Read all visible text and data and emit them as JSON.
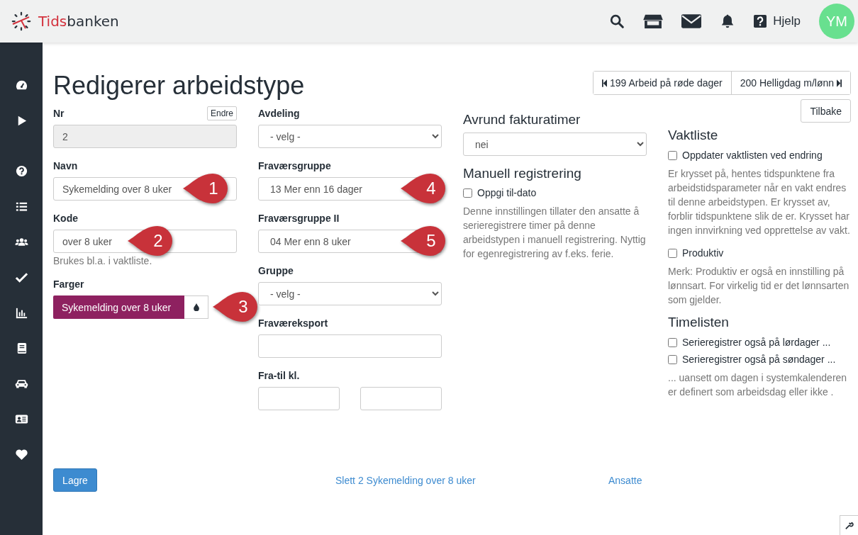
{
  "header": {
    "logo_primary": "Tids",
    "logo_secondary": "banken",
    "help_label": "Hjelp",
    "avatar_initials": "YM"
  },
  "page_title": "Redigerer arbeidstype",
  "nav": {
    "previous": "199 Arbeid på røde dager",
    "next": "200 Helligdag m/lønn"
  },
  "fields_left": [
    {
      "kind": "readonly",
      "label": "Nr",
      "action": "Endre",
      "value": "2"
    },
    {
      "kind": "text",
      "label": "Navn",
      "value": "Sykemelding over 8 uker",
      "callout": "1"
    },
    {
      "kind": "text",
      "label": "Kode",
      "value": "over 8 uker",
      "help": "Brukes bl.a. i vaktliste.",
      "callout": "2"
    },
    {
      "kind": "color",
      "label": "Farger",
      "value": "Sykemelding over 8 uker",
      "color": "#8e2160",
      "callout": "3"
    }
  ],
  "fields_middle": [
    {
      "kind": "select",
      "label": "Avdeling",
      "value": "- velg -"
    },
    {
      "kind": "select",
      "label": "Fraværsgruppe",
      "value": "13 Mer enn 16 dager",
      "callout": "4"
    },
    {
      "kind": "select",
      "label": "Fraværsgruppe II",
      "value": "04 Mer enn 8 uker",
      "callout": "5"
    },
    {
      "kind": "select",
      "label": "Gruppe",
      "value": "- velg -"
    },
    {
      "kind": "text",
      "label": "Fraværeksport"
    },
    {
      "kind": "range",
      "label": "Fra-til kl."
    }
  ],
  "rounding": {
    "heading": "Avrund fakturatimer",
    "value": "nei"
  },
  "manual": {
    "heading": "Manuell registrering",
    "options": [
      {
        "label": "Oppgi til-dato",
        "checked": false
      }
    ],
    "note": "Denne innstillingen tillater den ansatte å serieregistrere timer på denne arbeidstypen i manuell registrering. Nyttig for egenregistrering av f.eks. ferie."
  },
  "right_panel": {
    "back": "Tilbake",
    "sections": [
      {
        "heading": "Vaktliste",
        "items": [
          {
            "kind": "checkbox",
            "label": "Oppdater vaktlisten ved endring",
            "checked": false
          },
          {
            "kind": "note",
            "text": "Er krysset på, hentes tidspunktene fra arbeidstidsparameter når en vakt endres til denne arbeidstypen. Er krysset av, forblir tidspunktene slik de er. Krysset har ingen innvirkning ved opprettelse av vakt."
          },
          {
            "kind": "checkbox",
            "label": "Produktiv",
            "checked": false
          },
          {
            "kind": "note",
            "text": "Merk: Produktiv er også en innstilling på lønnsart. For virkelig tid er det lønnsarten som gjelder."
          }
        ]
      },
      {
        "heading": "Timelisten",
        "items": [
          {
            "kind": "checkbox",
            "label": "Serieregistrer også på lørdager ...",
            "checked": false
          },
          {
            "kind": "checkbox",
            "label": "Serieregistrer også på søndager ...",
            "checked": false
          },
          {
            "kind": "note",
            "text": "... uansett om dagen i systemkalenderen er definert som arbeidsdag eller ikke ."
          }
        ]
      }
    ]
  },
  "footer": {
    "save": "Lagre",
    "delete_link": "Slett 2 Sykemelding over 8 uker",
    "employees_link": "Ansatte"
  }
}
